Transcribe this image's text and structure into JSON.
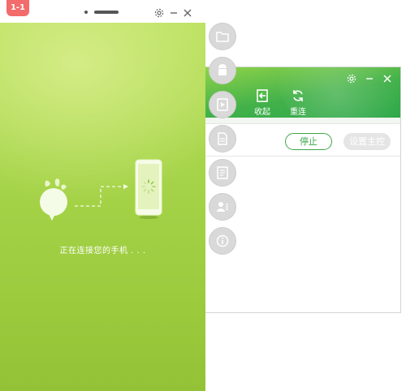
{
  "main_window": {
    "badge": "1-1",
    "status_text": "正在连接您的手机 . . ."
  },
  "bg_window": {
    "tools": [
      {
        "label": "收起",
        "icon": "collapse-icon"
      },
      {
        "label": "重连",
        "icon": "refresh-icon"
      }
    ],
    "buttons": {
      "stop_label": "停止",
      "set_host_label": "设置主控"
    }
  },
  "side_icons": [
    "folder-icon",
    "android-icon",
    "video-icon",
    "document-icon",
    "list-icon",
    "contacts-icon",
    "info-icon"
  ],
  "colors": {
    "accent_green": "#3fa74a",
    "badge_red": "#f36b6b",
    "panel_lime": "#a6d44a"
  }
}
